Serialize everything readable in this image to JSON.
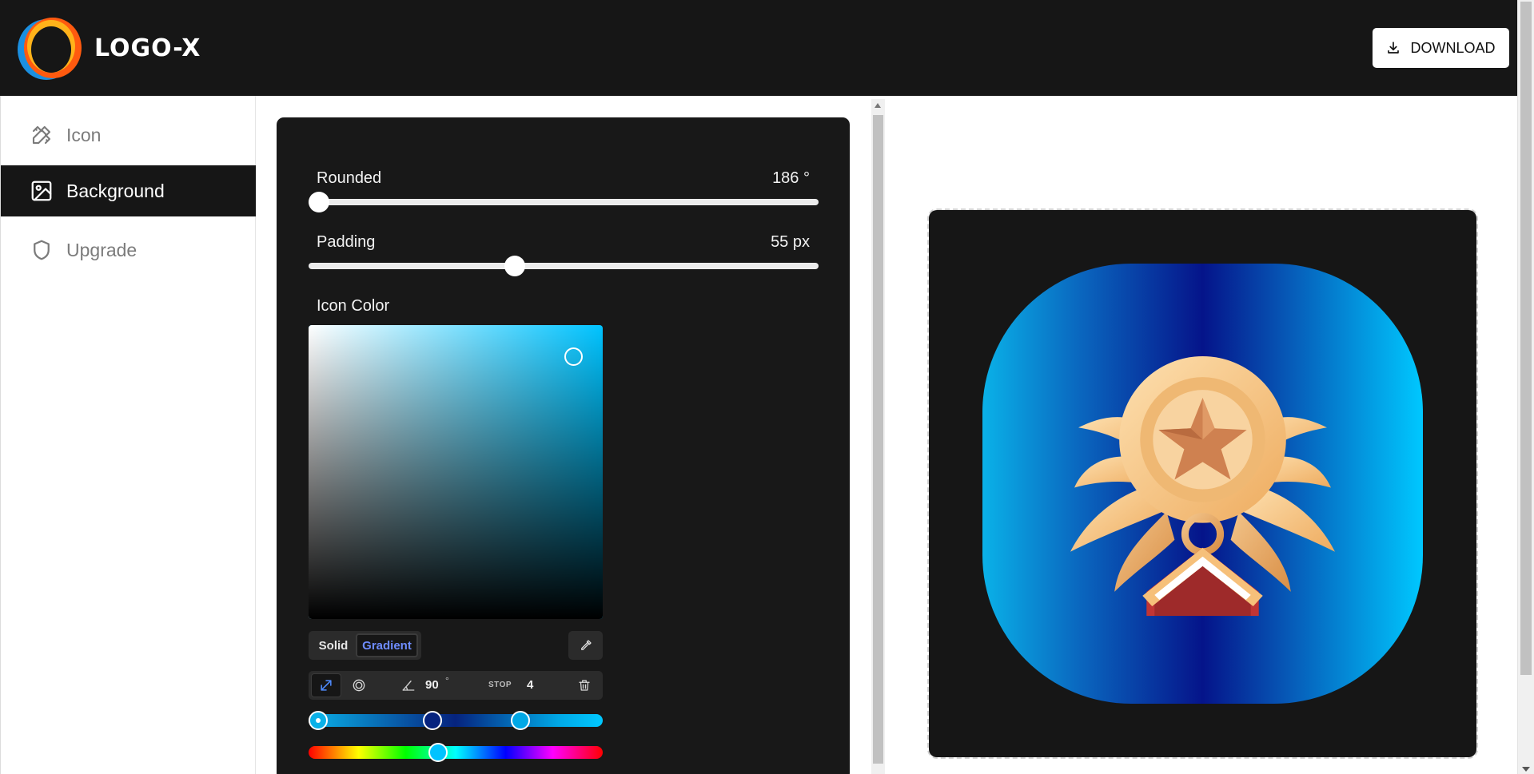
{
  "header": {
    "logo_text": "LOGO-X",
    "download_label": "DOWNLOAD"
  },
  "sidebar": {
    "items": [
      {
        "label": "Icon",
        "icon": "pencil-ruler-icon",
        "active": false
      },
      {
        "label": "Background",
        "icon": "image-icon",
        "active": true
      },
      {
        "label": "Upgrade",
        "icon": "shield-icon",
        "active": false
      }
    ]
  },
  "panel": {
    "rounded": {
      "label": "Rounded",
      "value": "186 °"
    },
    "padding": {
      "label": "Padding",
      "value": "55 px"
    },
    "icon_color_label": "Icon Color",
    "picker": {
      "mode_solid": "Solid",
      "mode_gradient": "Gradient",
      "angle": "90",
      "angle_unit": "°",
      "stop_label": "STOP",
      "stop_value": "4",
      "stop_colors": [
        "#0ab1e8",
        "#06237e",
        "#00a8e6"
      ],
      "hue_color": "#00c3ff"
    }
  },
  "colors": {
    "header_bg": "#161616",
    "accent_blue": "#6e8cff",
    "preview_gradient": [
      "#0ab1e8",
      "#05148a",
      "#00c8ff"
    ],
    "medal_gold": "#f6c07a",
    "medal_red": "#c03535"
  }
}
